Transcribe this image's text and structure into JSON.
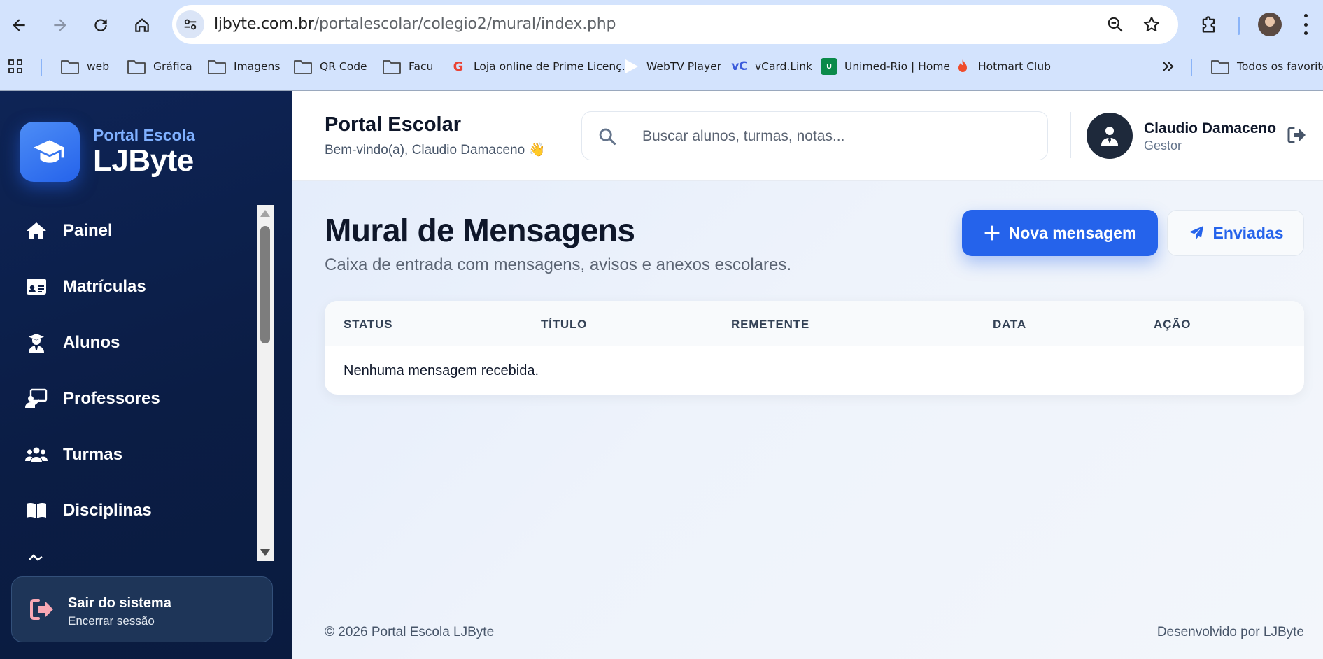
{
  "browser": {
    "url_domain": "ljbyte.com.br",
    "url_path": "/portalescolar/colegio2/mural/index.php",
    "bookmarks": [
      {
        "label": "web",
        "icon": "folder-icon"
      },
      {
        "label": "Gráfica",
        "icon": "folder-icon"
      },
      {
        "label": "Imagens",
        "icon": "folder-icon"
      },
      {
        "label": "QR Code",
        "icon": "folder-icon"
      },
      {
        "label": "Facu",
        "icon": "folder-icon"
      },
      {
        "label": "Loja online de Prime Licenç...",
        "icon": "google-favicon"
      },
      {
        "label": "WebTV Player",
        "icon": "play-favicon"
      },
      {
        "label": "vCard.Link",
        "icon": "vc-favicon"
      },
      {
        "label": "Unimed-Rio | Home",
        "icon": "unimed-favicon"
      },
      {
        "label": "Hotmart Club",
        "icon": "hotmart-favicon"
      }
    ],
    "all_bookmarks": "Todos os favoritos"
  },
  "sidebar": {
    "brand_sub": "Portal Escola",
    "brand_title": "LJByte",
    "items": [
      {
        "label": "Painel",
        "icon": "home-icon"
      },
      {
        "label": "Matrículas",
        "icon": "id-card-icon"
      },
      {
        "label": "Alunos",
        "icon": "student-icon"
      },
      {
        "label": "Professores",
        "icon": "teacher-icon"
      },
      {
        "label": "Turmas",
        "icon": "users-icon"
      },
      {
        "label": "Disciplinas",
        "icon": "book-icon"
      }
    ],
    "logout_title": "Sair do sistema",
    "logout_sub": "Encerrar sessão"
  },
  "header": {
    "title": "Portal Escolar",
    "welcome": "Bem-vindo(a), Claudio Damaceno 👋",
    "search_placeholder": "Buscar alunos, turmas, notas...",
    "user_name": "Claudio Damaceno",
    "user_role": "Gestor"
  },
  "page": {
    "title": "Mural de Mensagens",
    "subtitle": "Caixa de entrada com mensagens, avisos e anexos escolares.",
    "new_button": "Nova mensagem",
    "sent_button": "Enviadas",
    "columns": [
      "STATUS",
      "TÍTULO",
      "REMETENTE",
      "DATA",
      "AÇÃO"
    ],
    "empty_message": "Nenhuma mensagem recebida."
  },
  "footer": {
    "copyright": "© 2026 Portal Escola LJByte",
    "credit": "Desenvolvido por LJByte"
  },
  "colors": {
    "sidebar_bg": "#0b1d45",
    "accent": "#2563eb",
    "brand_sub": "#7fb0ff",
    "chrome_bg": "#d3e3fd"
  }
}
